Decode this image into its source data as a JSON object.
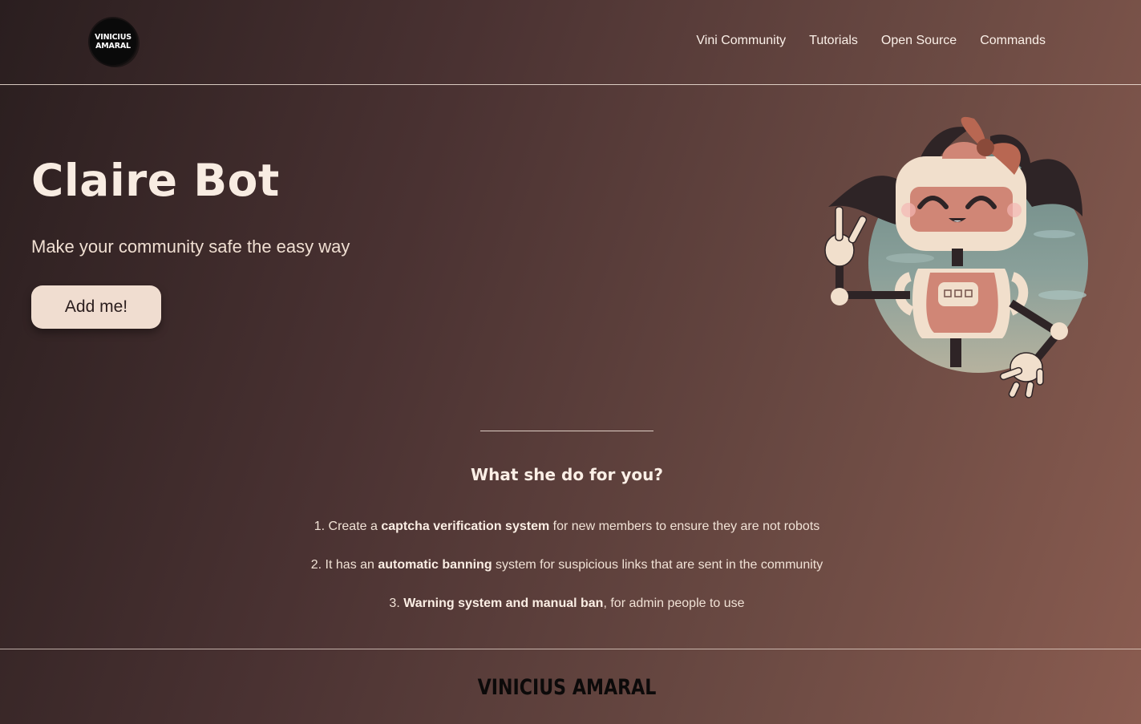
{
  "header": {
    "logo_line1": "VINICIUS",
    "logo_line2": "AMARAL",
    "nav": [
      {
        "label": "Vini Community"
      },
      {
        "label": "Tutorials"
      },
      {
        "label": "Open Source"
      },
      {
        "label": "Commands"
      }
    ]
  },
  "hero": {
    "title": "Claire Bot",
    "subtitle": "Make your community safe the easy way",
    "cta_label": "Add me!",
    "illustration": "robot-girl-mascot-icon"
  },
  "features": {
    "title": "What she do for you?",
    "items": [
      {
        "prefix": "1. Create a ",
        "bold": "captcha verification system",
        "suffix": " for new members to ensure they are not robots"
      },
      {
        "prefix": "2. It has an ",
        "bold": "automatic banning",
        "suffix": " system for suspicious links that are sent in the community"
      },
      {
        "prefix": "3. ",
        "bold": "Warning system and manual ban",
        "suffix": ", for admin people to use"
      }
    ]
  },
  "footer": {
    "logo_text": "VINICIUS AMARAL"
  },
  "colors": {
    "bg_dark": "#2a1e1f",
    "bg_light": "#8a5c50",
    "button_bg": "#f0ddd0",
    "text": "#f3e4d8"
  }
}
